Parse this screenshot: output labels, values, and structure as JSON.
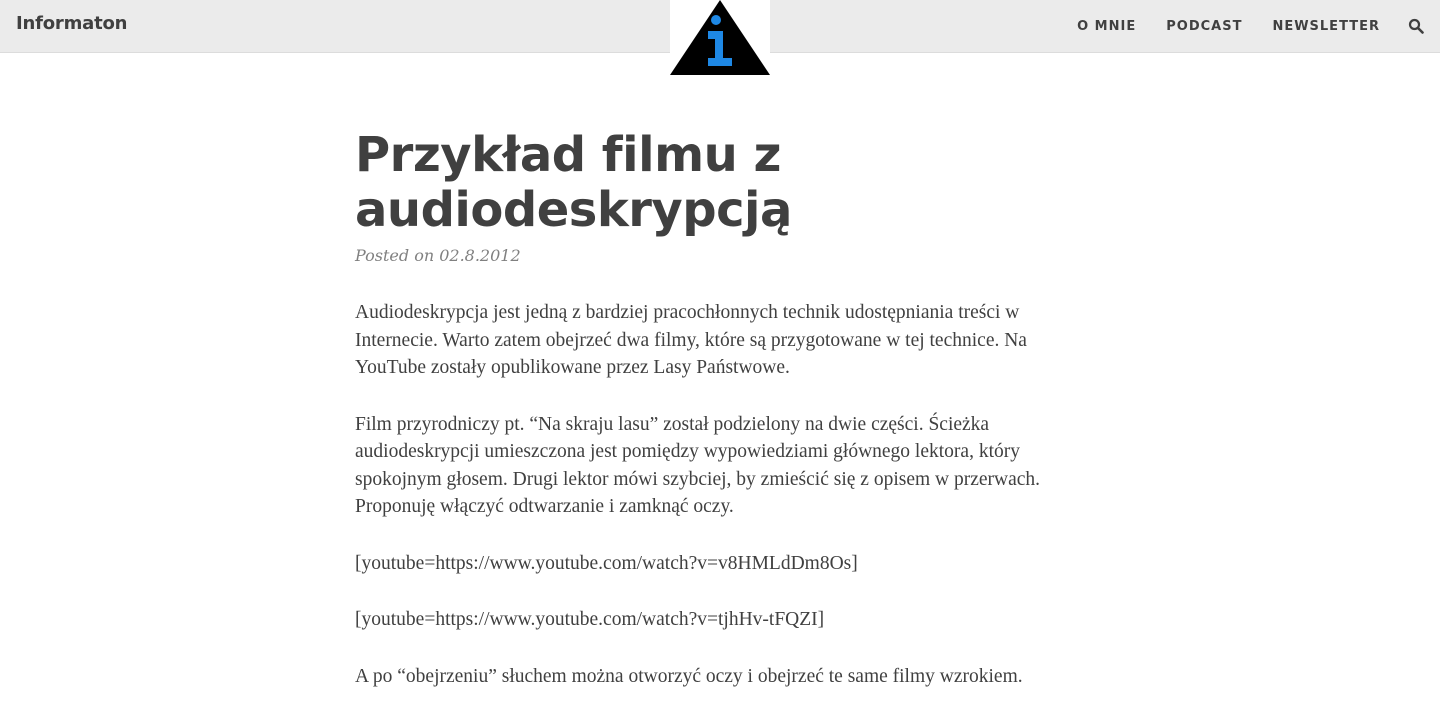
{
  "header": {
    "brand": "Informaton",
    "nav": [
      "O MNIE",
      "PODCAST",
      "NEWSLETTER"
    ],
    "logo_icon": "info-triangle-icon",
    "logo_colors": {
      "triangle": "#000000",
      "letter": "#1e88e5"
    },
    "search_icon": "search-icon"
  },
  "post": {
    "title": "Przykład filmu z audiodeskrypcją",
    "meta": "Posted on 02.8.2012",
    "paragraphs": [
      "Audiodeskrypcja jest jedną z bardziej pracochłonnych technik udostępniania treści w Internecie. Warto zatem obejrzeć dwa filmy, które są przygotowane w tej technice. Na YouTube zostały opublikowane przez Lasy Państwowe.",
      "Film przyrodniczy pt. “Na skraju lasu” został podzielony na dwie części. Ścieżka audiodeskrypcji umieszczona jest pomiędzy wypowiedziami głównego lektora, który spokojnym głosem. Drugi lektor mówi szybciej, by zmieścić się z opisem w przerwach. Proponuję włączyć odtwarzanie i zamknąć oczy.",
      "[youtube=https://www.youtube.com/watch?v=v8HMLdDm8Os]",
      "[youtube=https://www.youtube.com/watch?v=tjhHv-tFQZI]",
      "A po “obejrzeniu” słuchem można otworzyć oczy i obejrzeć te same filmy wzrokiem."
    ]
  }
}
